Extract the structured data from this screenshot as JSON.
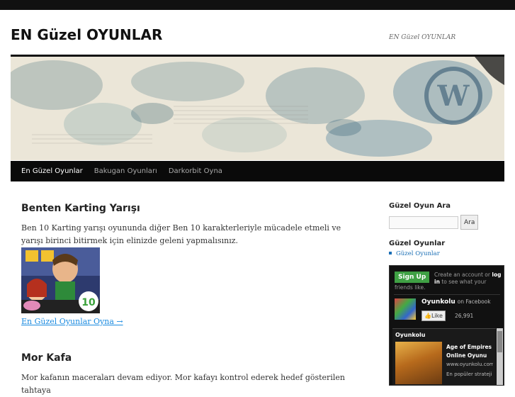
{
  "site": {
    "title": "EN Güzel OYUNLAR",
    "description": "EN Güzel OYUNLAR"
  },
  "nav": {
    "items": [
      "En Güzel Oyunlar",
      "Bakugan Oyunları",
      "Darkorbit Oyna"
    ]
  },
  "posts": [
    {
      "title": "Benten Karting Yarışı",
      "body": "Ben 10 Karting yarışı oyununda diğer Ben 10 karakterleriyle mücadele etmeli ve yarışı birinci bitirmek için elinizde geleni yapmalısınız.",
      "more": "En Güzel Oyunlar Oyna →"
    },
    {
      "title": "Mor Kafa",
      "body": "Mor kafanın maceraları devam ediyor. Mor kafayı kontrol ederek hedef gösterilen tahtaya"
    }
  ],
  "sidebar": {
    "search_title": "Güzel Oyun Ara",
    "search_button": "Ara",
    "search_value": "",
    "categories_title": "Güzel Oyunlar",
    "categories": [
      "Güzel Oyunlar"
    ]
  },
  "facebook": {
    "signup": "Sign Up",
    "create_prefix": "Create an account or",
    "login": "log in",
    "create_suffix": "to see what your",
    "friends_like": "friends like.",
    "page_name": "Oyunkolu",
    "on_facebook": "on Facebook",
    "like": "Like",
    "like_count": "26,991",
    "feed_title": "Oyunkolu",
    "feed_item_title": "Age of Empires Online Oyunu",
    "feed_item_url": "www.oyunkolu.com",
    "feed_item_sub": "En popüler strateji"
  },
  "colors": {
    "link": "#1b8be0",
    "nav_bg": "#0a0a0a",
    "signup_green": "#3fa044"
  }
}
